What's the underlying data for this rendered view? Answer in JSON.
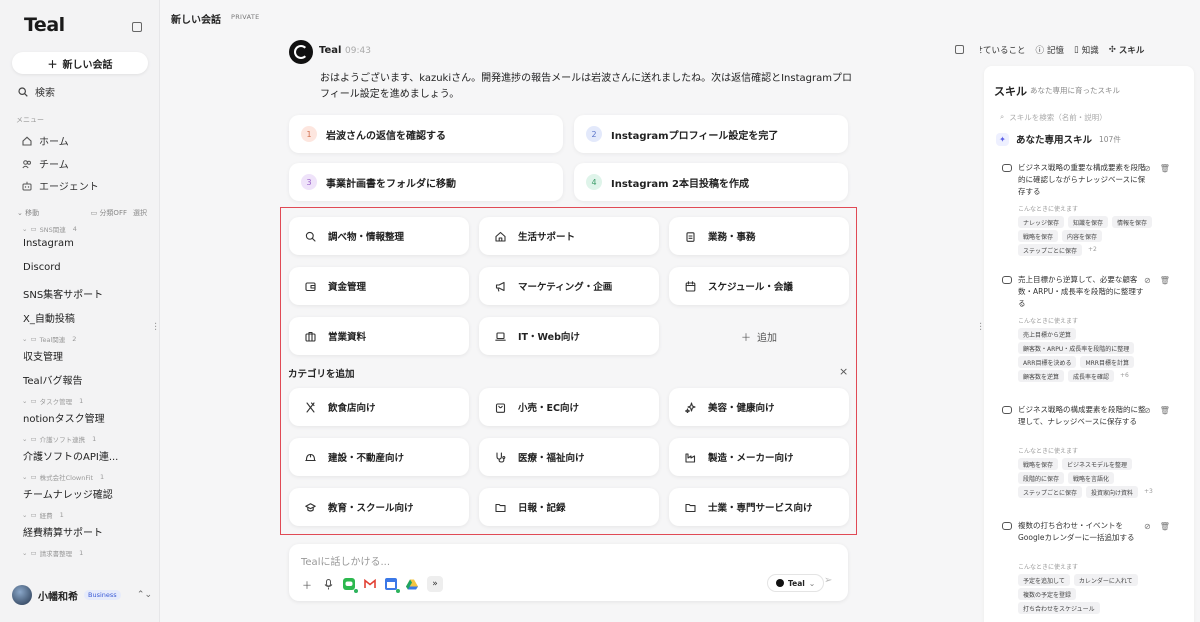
{
  "sidebar": {
    "logo": "Teal",
    "new_chat": "新しい会話",
    "search": "検索",
    "menu_label": "メニュー",
    "nav": [
      {
        "label": "ホーム",
        "icon": "home-icon"
      },
      {
        "label": "チーム",
        "icon": "team-icon"
      },
      {
        "label": "エージェント",
        "icon": "agent-icon"
      }
    ],
    "folder_header": {
      "label": "移動",
      "group_off": "分類OFF",
      "select": "選択"
    },
    "entries": [
      {
        "kind": "folder",
        "label": "SNS関連",
        "count": "4"
      },
      {
        "kind": "chat",
        "label": "Instagram"
      },
      {
        "kind": "chat",
        "label": "Discord"
      },
      {
        "kind": "chat",
        "label": "SNS集客サポート"
      },
      {
        "kind": "chat",
        "label": "X_自動投稿"
      },
      {
        "kind": "folder",
        "label": "Teal関連",
        "count": "2"
      },
      {
        "kind": "chat",
        "label": "収支管理"
      },
      {
        "kind": "chat",
        "label": "Tealバグ報告"
      },
      {
        "kind": "folder",
        "label": "タスク管理",
        "count": "1"
      },
      {
        "kind": "chat",
        "label": "notionタスク管理"
      },
      {
        "kind": "folder",
        "label": "介護ソフト連携",
        "count": "1"
      },
      {
        "kind": "chat",
        "label": "介護ソフトのAPI連..."
      },
      {
        "kind": "folder",
        "label": "株式会社ClownFit",
        "count": "1"
      },
      {
        "kind": "chat",
        "label": "チームナレッジ確認"
      },
      {
        "kind": "folder",
        "label": "経費",
        "count": "1"
      },
      {
        "kind": "chat",
        "label": "経費精算サポート"
      },
      {
        "kind": "folder",
        "label": "請求書整理",
        "count": "1"
      }
    ],
    "user": {
      "name": "小幡和希",
      "plan": "Business"
    }
  },
  "header": {
    "title": "新しい会話",
    "visibility": "PRIVATE"
  },
  "message": {
    "sender": "Teal",
    "time": "09:43",
    "text": "おはようございます、kazukiさん。開発進捗の報告メールは岩波さんに送れましたね。次は返信確認とInstagramプロフィール設定を進めましょう。"
  },
  "suggestions": [
    {
      "num": "1",
      "label": "岩波さんの返信を確認する",
      "color": "#fde6df",
      "text_color": "#d2714f"
    },
    {
      "num": "2",
      "label": "Instagramプロフィール設定を完了",
      "color": "#e3e9fb",
      "text_color": "#5b74c9"
    },
    {
      "num": "3",
      "label": "事業計画書をフォルダに移動",
      "color": "#efe3fa",
      "text_color": "#9a62c8"
    },
    {
      "num": "4",
      "label": "Instagram 2本目投稿を作成",
      "color": "#dff4ea",
      "text_color": "#3d9c6a"
    }
  ],
  "categories": [
    {
      "label": "調べ物・情報整理",
      "icon": "search-icon"
    },
    {
      "label": "生活サポート",
      "icon": "home-icon"
    },
    {
      "label": "業務・事務",
      "icon": "clipboard-icon"
    },
    {
      "label": "資金管理",
      "icon": "wallet-icon"
    },
    {
      "label": "マーケティング・企画",
      "icon": "megaphone-icon"
    },
    {
      "label": "スケジュール・会議",
      "icon": "calendar-icon"
    },
    {
      "label": "営業資料",
      "icon": "briefcase-icon"
    },
    {
      "label": "IT・Web向け",
      "icon": "laptop-icon"
    }
  ],
  "add_label": "追加",
  "add_category": {
    "heading": "カテゴリを追加",
    "close": "×",
    "items": [
      {
        "label": "飲食店向け",
        "icon": "utensils-icon"
      },
      {
        "label": "小売・EC向け",
        "icon": "shopping-bag-icon"
      },
      {
        "label": "美容・健康向け",
        "icon": "sparkles-icon"
      },
      {
        "label": "建設・不動産向け",
        "icon": "helmet-icon"
      },
      {
        "label": "医療・福祉向け",
        "icon": "stethoscope-icon"
      },
      {
        "label": "製造・メーカー向け",
        "icon": "factory-icon"
      },
      {
        "label": "教育・スクール向け",
        "icon": "graduation-cap-icon"
      },
      {
        "label": "日報・記録",
        "icon": "folder-icon"
      },
      {
        "label": "士業・専門サービス向け",
        "icon": "folder-icon"
      }
    ]
  },
  "composer": {
    "placeholder": "Tealに話しかける...",
    "model": "Teal",
    "more": "»"
  },
  "right": {
    "tabs": [
      {
        "label": "任せていること",
        "icon": "task-icon"
      },
      {
        "label": "記憶",
        "icon": "memory-icon"
      },
      {
        "label": "知識",
        "icon": "book-icon"
      },
      {
        "label": "スキル",
        "icon": "skill-icon",
        "active": true
      }
    ],
    "title": "スキル",
    "subtitle": "あなた専用に育ったスキル",
    "search_placeholder": "スキルを検索（名前・説明）",
    "section": {
      "label": "あなた専用スキル",
      "count": "107件"
    },
    "when_label": "こんなときに使えます",
    "skills": [
      {
        "title": "ビジネス戦略の重要な構成要素を段階的に確認しながらナレッジベースに保存する",
        "tags": [
          "ナレッジ保存",
          "知識を保存",
          "情報を保存",
          "戦略を保存",
          "内容を保存",
          "ステップごとに保存"
        ],
        "more": "+2"
      },
      {
        "title": "売上目標から逆算して、必要な顧客数・ARPU・成長率を段階的に整理する",
        "tags": [
          "売上目標から逆算",
          "顧客数・ARPU・成長率を段階的に整理",
          "ARR目標を決める",
          "MRR目標を計算",
          "顧客数を逆算",
          "成長率を確認"
        ],
        "more": "+6"
      },
      {
        "title": "ビジネス戦略の構成要素を段階的に整理して、ナレッジベースに保存する",
        "tags": [
          "戦略を保存",
          "ビジネスモデルを整理",
          "段階的に保存",
          "戦略を言語化",
          "ステップごとに保存",
          "投資家向け資料"
        ],
        "more": "+3"
      },
      {
        "title": "複数の打ち合わせ・イベントをGoogleカレンダーに一括追加する",
        "tags": [
          "予定を追加して",
          "カレンダーに入れて",
          "複数の予定を登録",
          "打ち合わせをスケジュール"
        ],
        "more": ""
      }
    ]
  }
}
